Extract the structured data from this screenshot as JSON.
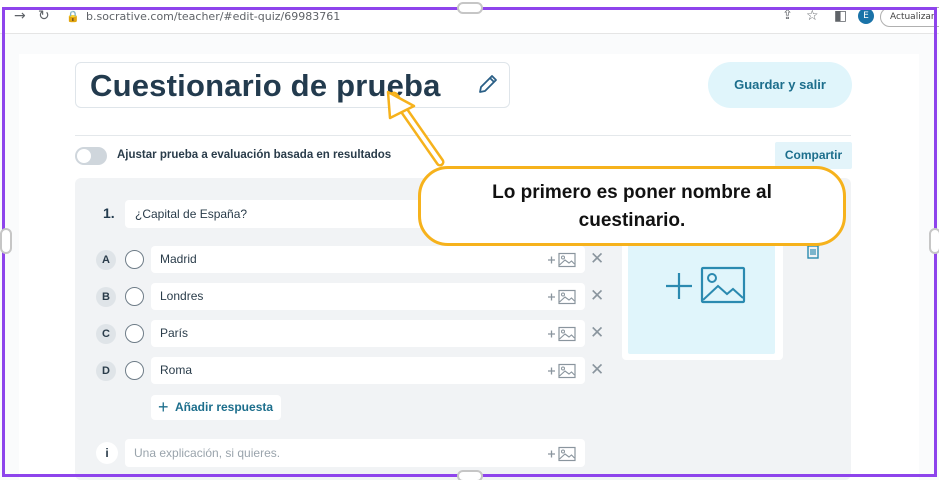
{
  "browser": {
    "url": "b.socrative.com/teacher/#edit-quiz/69983761",
    "profile_initial": "E",
    "update_label": "Actualizar"
  },
  "quiz": {
    "title": "Cuestionario de prueba",
    "save_label": "Guardar y salir",
    "toggle_label": "Ajustar prueba a evaluación basada en resultados",
    "share_label": "Compartir"
  },
  "question": {
    "number": "1.",
    "text": "¿Capital de España?",
    "answers": [
      {
        "letter": "A",
        "text": "Madrid"
      },
      {
        "letter": "B",
        "text": "Londres"
      },
      {
        "letter": "C",
        "text": "París"
      },
      {
        "letter": "D",
        "text": "Roma"
      }
    ],
    "add_answer_label": "Añadir respuesta",
    "explanation_marker": "i",
    "explanation_placeholder": "Una explicación, si quieres."
  },
  "annotation": {
    "line1": "Lo primero es poner nombre al",
    "line2": "cuestinario."
  },
  "colors": {
    "frame": "#8e44ec",
    "accent": "#1c6e8c",
    "callout_border": "#f6b21c"
  }
}
